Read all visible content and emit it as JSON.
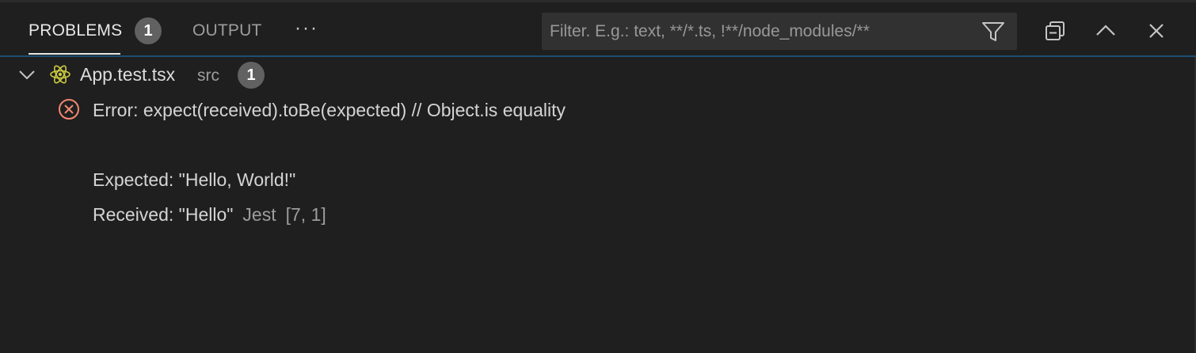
{
  "tabs": {
    "problems_label": "PROBLEMS",
    "problems_count": "1",
    "output_label": "OUTPUT",
    "more_label": "···"
  },
  "filter": {
    "placeholder": "Filter. E.g.: text, **/*.ts, !**/node_modules/**",
    "value": ""
  },
  "icons": {
    "filter": "filter-icon",
    "collapse_all": "collapse-all-icon",
    "maximize": "chevron-up-icon",
    "close": "close-icon",
    "expand": "chevron-down-icon",
    "file": "react-icon",
    "error": "error-icon"
  },
  "colors": {
    "accent_border": "#1c4f73",
    "error": "#f48771",
    "react": "#cbcb41",
    "badge": "#616161"
  },
  "file": {
    "name": "App.test.tsx",
    "folder": "src",
    "problem_count": "1"
  },
  "problem": {
    "message_line1": "Error: expect(received).toBe(expected) // Object.is equality",
    "message_line2": "",
    "message_line3": "Expected: \"Hello, World!\"",
    "message_line4": "Received: \"Hello\"",
    "source": "Jest",
    "location": "[7, 1]"
  }
}
